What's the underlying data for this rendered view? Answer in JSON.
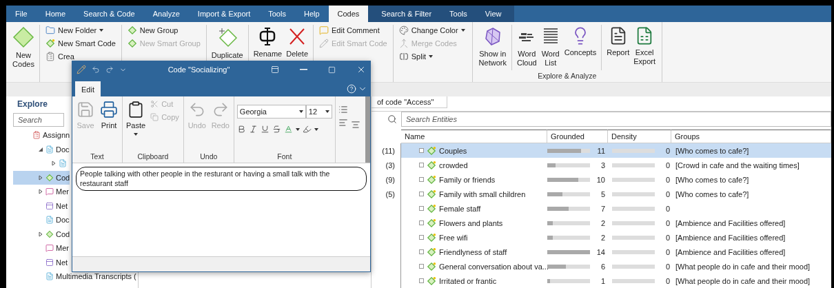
{
  "menu": [
    {
      "label": "File",
      "selected": false
    },
    {
      "label": "Home",
      "selected": false
    },
    {
      "label": "Search & Code",
      "selected": false
    },
    {
      "label": "Analyze",
      "selected": false
    },
    {
      "label": "Import & Export",
      "selected": false
    },
    {
      "label": "Tools",
      "selected": false
    },
    {
      "label": "Help",
      "selected": false
    },
    {
      "label": "Codes",
      "selected": true
    }
  ],
  "context_menu": [
    {
      "label": "Search & Filter",
      "selected": false
    },
    {
      "label": "Tools",
      "selected": false
    },
    {
      "label": "View",
      "selected": false
    }
  ],
  "ribbon": {
    "groups": [
      {
        "columns": [
          {
            "items": [
              {
                "kind": "large",
                "label": "New Codes",
                "disabled": false,
                "dropdown": false
              }
            ]
          },
          {
            "items": [
              {
                "kind": "small",
                "label": "New Folder",
                "disabled": false,
                "dropdown": true
              },
              {
                "kind": "small",
                "label": "New Smart Code",
                "disabled": false,
                "dropdown": false
              },
              {
                "kind": "small",
                "label": "Crea",
                "disabled": false,
                "dropdown": false
              }
            ]
          },
          {
            "items": [
              {
                "kind": "small",
                "label": "New Group",
                "disabled": false,
                "dropdown": false
              },
              {
                "kind": "small",
                "label": "New Smart Group",
                "disabled": true,
                "dropdown": false
              }
            ]
          },
          {
            "items": [
              {
                "kind": "large",
                "label": "Duplicate",
                "disabled": false,
                "dropdown": false
              }
            ]
          },
          {
            "items": [
              {
                "kind": "large",
                "label": "Rename",
                "disabled": false,
                "dropdown": false
              },
              {
                "kind": "large",
                "label": "Delete",
                "disabled": false,
                "dropdown": false
              }
            ]
          },
          {
            "items": [
              {
                "kind": "small",
                "label": "Edit Comment",
                "disabled": false,
                "dropdown": false
              },
              {
                "kind": "small",
                "label": "Edit Smart Code",
                "disabled": true,
                "dropdown": false
              }
            ]
          },
          {
            "items": [
              {
                "kind": "small",
                "label": "Change Color",
                "disabled": false,
                "dropdown": true
              },
              {
                "kind": "small",
                "label": "Merge Codes",
                "disabled": true,
                "dropdown": false
              },
              {
                "kind": "small",
                "label": "Split",
                "disabled": false,
                "dropdown": true
              }
            ]
          }
        ]
      },
      {
        "label": "Explore & Analyze",
        "columns": [
          {
            "items": [
              {
                "kind": "large",
                "label": "Show in Network",
                "disabled": false,
                "dropdown": false
              }
            ]
          },
          {
            "items": [
              {
                "kind": "large",
                "label": "Word Cloud",
                "disabled": false,
                "dropdown": false
              },
              {
                "kind": "large",
                "label": "Word List",
                "disabled": false,
                "dropdown": false
              },
              {
                "kind": "large",
                "label": "Concepts",
                "disabled": false,
                "dropdown": false
              }
            ]
          },
          {
            "items": [
              {
                "kind": "large",
                "label": "Report",
                "disabled": false,
                "dropdown": false
              },
              {
                "kind": "large",
                "label": "Excel Export",
                "disabled": false,
                "dropdown": false
              }
            ]
          }
        ]
      }
    ]
  },
  "explore": {
    "title": "Explore",
    "search": {
      "placeholder": "Search"
    },
    "tree": [
      {
        "label": "Assignn",
        "kind": "assignments",
        "selected": false,
        "children": [
          {
            "label": "Doc",
            "kind": "documents",
            "selected": false,
            "expanded": true,
            "children": [
              {
                "kind": "document",
                "selected": false,
                "expanded": false
              }
            ]
          },
          {
            "label": "Cod",
            "kind": "codes",
            "selected": true,
            "expanded": false
          },
          {
            "label": "Mer",
            "kind": "memos",
            "selected": false,
            "expanded": false
          },
          {
            "label": "Net",
            "kind": "networks",
            "selected": false
          },
          {
            "label": "Doc",
            "kind": "documents",
            "selected": false
          },
          {
            "label": "Cod",
            "kind": "codes",
            "selected": false,
            "expanded": false
          },
          {
            "label": "Mer",
            "kind": "memos",
            "selected": false
          },
          {
            "label": "Net",
            "kind": "networks",
            "selected": false
          },
          {
            "label": "Multimedia Transcripts (",
            "kind": "documents",
            "selected": false
          }
        ]
      }
    ]
  },
  "entities": {
    "tab": "of code \"Access\"",
    "search": {
      "placeholder": "Search Entities"
    },
    "columns": [
      "Name",
      "Grounded",
      "Density",
      "Groups"
    ],
    "rows": [
      {
        "count": "(11)",
        "name": "Couples",
        "selected": true,
        "grounded": {
          "reading": "11",
          "level": 0.79
        },
        "density": {
          "reading": "0",
          "level": 0
        },
        "group": "[Who comes to cafe?]"
      },
      {
        "count": "(3)",
        "name": "crowded",
        "selected": false,
        "grounded": {
          "reading": "3",
          "level": 0.2
        },
        "density": {
          "reading": "0",
          "level": 0
        },
        "group": "[Crowd in cafe and the waiting times]"
      },
      {
        "count": "(9)",
        "name": "Family or friends",
        "selected": false,
        "grounded": {
          "reading": "10",
          "level": 0.72
        },
        "density": {
          "reading": "0",
          "level": 0
        },
        "group": "[Who comes to cafe?]"
      },
      {
        "count": "(5)",
        "name": "Family with small children",
        "selected": false,
        "grounded": {
          "reading": "5",
          "level": 0.35
        },
        "density": {
          "reading": "0",
          "level": 0
        },
        "group": "[Who comes to cafe?]"
      },
      {
        "name": "Female staff",
        "selected": false,
        "grounded": {
          "reading": "7",
          "level": 0.5
        },
        "density": {
          "reading": "0",
          "level": 0
        }
      },
      {
        "name": "Flowers and plants",
        "selected": false,
        "grounded": {
          "reading": "2",
          "level": 0.13
        },
        "density": {
          "reading": "0",
          "level": 0
        },
        "group": "[Ambience and Facilities offered]"
      },
      {
        "name": "Free wifi",
        "selected": false,
        "grounded": {
          "reading": "2",
          "level": 0.13
        },
        "density": {
          "reading": "0",
          "level": 0
        },
        "group": "[Ambience and Facilities offered]"
      },
      {
        "name": "Friendlyness of staff",
        "selected": false,
        "grounded": {
          "reading": "14",
          "level": 1
        },
        "density": {
          "reading": "0",
          "level": 0
        },
        "group": "[Ambience and Facilities offered]"
      },
      {
        "name": "General conversation about va...",
        "selected": false,
        "grounded": {
          "reading": "6",
          "level": 0.43
        },
        "density": {
          "reading": "0",
          "level": 0
        },
        "group": "[What people do in cafe and their mood]"
      },
      {
        "name": "Irritated or frantic",
        "selected": false,
        "grounded": {
          "reading": "1",
          "level": 0.06
        },
        "density": {
          "reading": "0",
          "level": 0
        },
        "group": "[What people do in cafe and their mood]"
      }
    ]
  },
  "dialog": {
    "title": "Code \"Socializing\"",
    "tabs": [
      {
        "label": "Edit",
        "selected": true
      }
    ],
    "groups": [
      {
        "label": "Text",
        "buttons": [
          {
            "label": "Save",
            "disabled": true
          },
          {
            "label": "Print",
            "disabled": false
          }
        ]
      },
      {
        "label": "Clipboard",
        "buttons": [
          {
            "label": "Paste",
            "disabled": false
          },
          {
            "label": "Cut",
            "disabled": true
          },
          {
            "label": "Copy",
            "disabled": true
          }
        ]
      },
      {
        "label": "Undo",
        "buttons": [
          {
            "label": "Undo",
            "disabled": true
          },
          {
            "label": "Redo",
            "disabled": true
          }
        ]
      },
      {
        "label": "Font",
        "font": "Georgia",
        "size": "12"
      }
    ],
    "comment": "People talking with other people in the resturant or having a small talk with the restaurant staff"
  }
}
